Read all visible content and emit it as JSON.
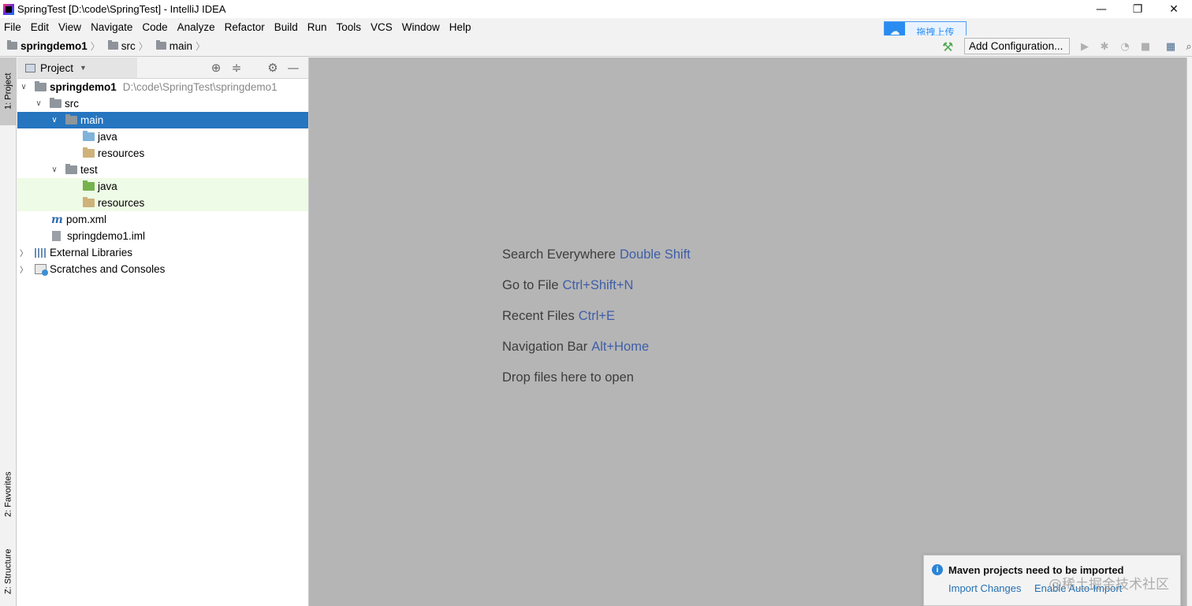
{
  "window": {
    "title": "SpringTest [D:\\code\\SpringTest] - IntelliJ IDEA",
    "controls": {
      "minimize": "—",
      "restore": "❐",
      "close": "✕"
    }
  },
  "menu": [
    "File",
    "Edit",
    "View",
    "Navigate",
    "Code",
    "Analyze",
    "Refactor",
    "Build",
    "Run",
    "Tools",
    "VCS",
    "Window",
    "Help"
  ],
  "upload_badge": {
    "label": "拖拽上传"
  },
  "navbar": {
    "breadcrumbs": [
      "springdemo1",
      "src",
      "main"
    ],
    "run_config": "Add Configuration..."
  },
  "left_stripe": {
    "project_tab": "1: Project",
    "favorites_tab": "2: Favorites",
    "structure_tab": "Z: Structure"
  },
  "project_panel": {
    "title": "Project",
    "tree": [
      {
        "label": "springdemo1",
        "hint": "D:\\code\\SpringTest\\springdemo1"
      },
      {
        "label": "src"
      },
      {
        "label": "main",
        "selected": true
      },
      {
        "label": "java"
      },
      {
        "label": "resources"
      },
      {
        "label": "test"
      },
      {
        "label": "java"
      },
      {
        "label": "resources"
      },
      {
        "label": "pom.xml"
      },
      {
        "label": "springdemo1.iml"
      },
      {
        "label": "External Libraries"
      },
      {
        "label": "Scratches and Consoles"
      }
    ]
  },
  "editor": {
    "hints": [
      {
        "text": "Search Everywhere",
        "shortcut": "Double Shift"
      },
      {
        "text": "Go to File",
        "shortcut": "Ctrl+Shift+N"
      },
      {
        "text": "Recent Files",
        "shortcut": "Ctrl+E"
      },
      {
        "text": "Navigation Bar",
        "shortcut": "Alt+Home"
      },
      {
        "text": "Drop files here to open",
        "shortcut": ""
      }
    ]
  },
  "notification": {
    "title": "Maven projects need to be imported",
    "actions": [
      "Import Changes",
      "Enable Auto-Import"
    ]
  },
  "watermark": "@稀土掘金技术社区",
  "colors": {
    "selection": "#2675bf",
    "editor_bg": "#b5b5b5",
    "shortcut": "#3f5ea8",
    "link": "#2470b3"
  }
}
